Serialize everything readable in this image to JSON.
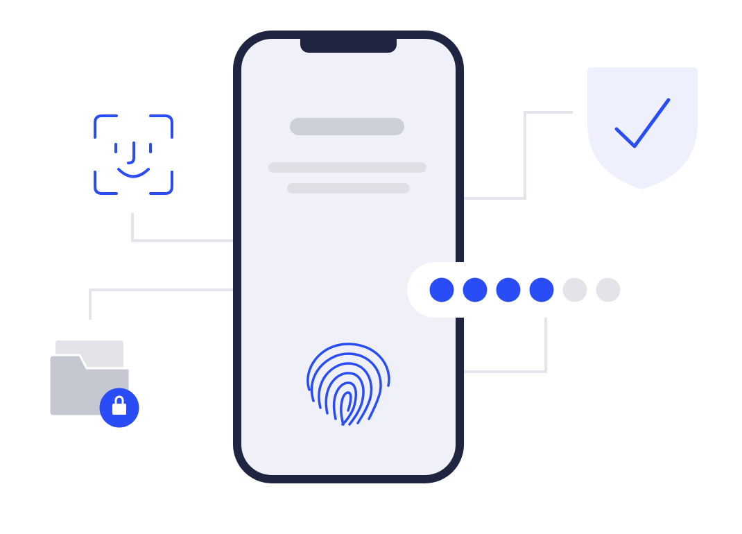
{
  "illustration": {
    "colors": {
      "accent": "#2a4cf6",
      "phone_frame": "#1f2440",
      "screen": "#f0f1f8",
      "connector": "#e4e5ea",
      "placeholder_dark": "#cdcfd6",
      "placeholder_light": "#dfe0e6",
      "shield": "#eef0fd",
      "folder": "#c5c8d0",
      "folder_back": "#e3e4ea",
      "pin_inactive": "#e3e4e9"
    },
    "icons": {
      "face": "face-id-icon",
      "fingerprint": "fingerprint-icon",
      "shield": "shield-check-icon",
      "folder": "locked-folder-icon",
      "lock": "lock-icon",
      "checkmark": "checkmark-icon"
    },
    "pin_entry": {
      "total_digits": 6,
      "entered_digits": 4
    }
  }
}
